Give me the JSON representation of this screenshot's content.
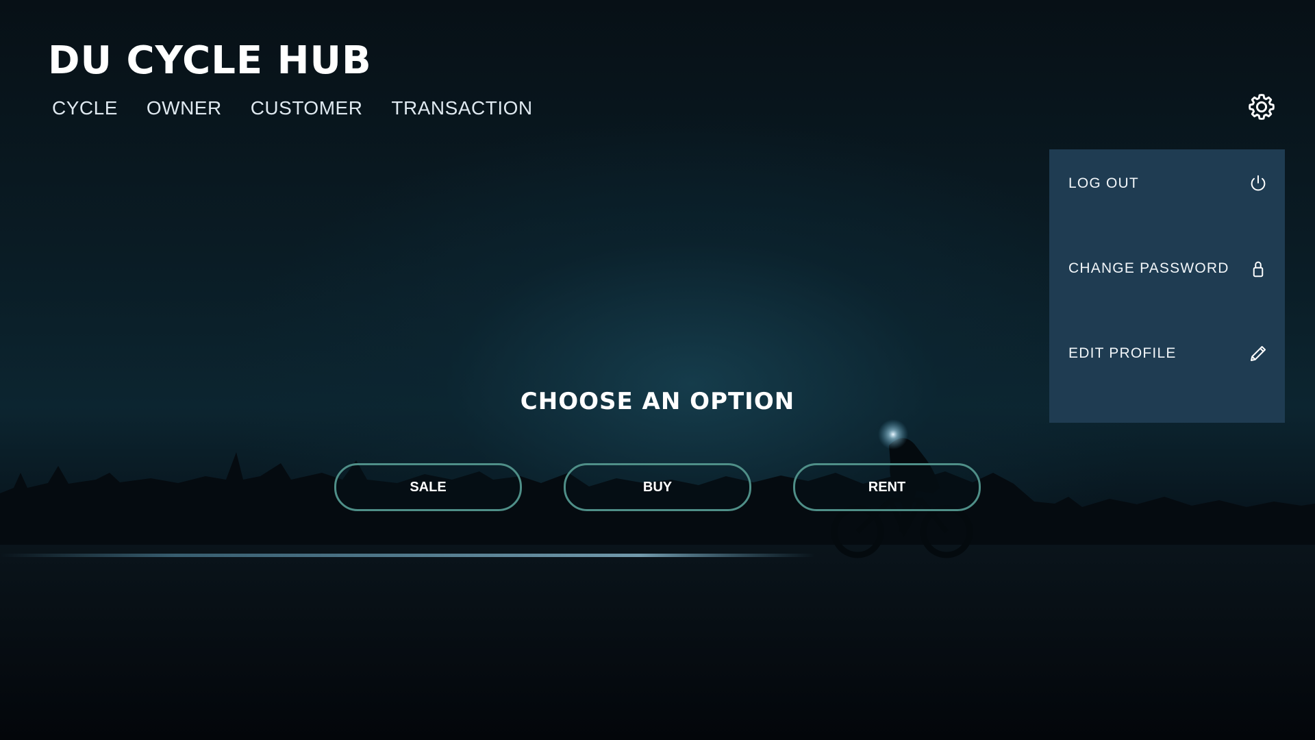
{
  "app": {
    "title": "DU CYCLE HUB"
  },
  "nav": {
    "items": [
      {
        "label": "CYCLE"
      },
      {
        "label": "OWNER"
      },
      {
        "label": "CUSTOMER"
      },
      {
        "label": "TRANSACTION"
      }
    ]
  },
  "settings": {
    "icon": "gear-icon",
    "menu": [
      {
        "label": "LOG OUT",
        "icon": "power-icon"
      },
      {
        "label": "CHANGE PASSWORD",
        "icon": "lock-icon"
      },
      {
        "label": "EDIT PROFILE",
        "icon": "pencil-icon"
      }
    ]
  },
  "main": {
    "heading": "CHOOSE AN OPTION",
    "options": [
      {
        "label": "SALE"
      },
      {
        "label": "BUY"
      },
      {
        "label": "RENT"
      }
    ]
  },
  "colors": {
    "menu_background": "#1f3c52",
    "button_border": "#4f8f88",
    "text": "#ffffff"
  }
}
